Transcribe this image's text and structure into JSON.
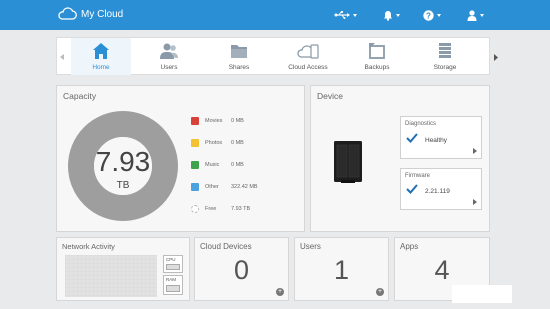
{
  "header": {
    "brand": "My Cloud"
  },
  "nav": {
    "items": [
      {
        "label": "Home",
        "active": true
      },
      {
        "label": "Users"
      },
      {
        "label": "Shares"
      },
      {
        "label": "Cloud Access"
      },
      {
        "label": "Backups"
      },
      {
        "label": "Storage"
      }
    ]
  },
  "capacity": {
    "title": "Capacity",
    "total_value": "7.93",
    "total_unit": "TB",
    "used_fraction": 0.0,
    "rows": [
      {
        "name": "Movies",
        "size": "0 MB",
        "icon": "movies-icon",
        "color": "#d9423a"
      },
      {
        "name": "Photos",
        "size": "0 MB",
        "icon": "photos-icon",
        "color": "#f2c230"
      },
      {
        "name": "Music",
        "size": "0 MB",
        "icon": "music-icon",
        "color": "#3fa34d"
      },
      {
        "name": "Other",
        "size": "322.42 MB",
        "icon": "other-icon",
        "color": "#4aa3df"
      },
      {
        "name": "Free",
        "size": "7.93 TB",
        "icon": "free-icon",
        "color": "#bbbbbb"
      }
    ]
  },
  "device": {
    "title": "Device",
    "diagnostics": {
      "title": "Diagnostics",
      "value": "Healthy"
    },
    "firmware": {
      "title": "Firmware",
      "value": "2.21.119"
    }
  },
  "network": {
    "title": "Network Activity",
    "cpu_label": "CPU",
    "ram_label": "RAM"
  },
  "cloud_devices": {
    "title": "Cloud Devices",
    "count": "0"
  },
  "users": {
    "title": "Users",
    "count": "1"
  },
  "apps": {
    "title": "Apps",
    "count": "4"
  },
  "colors": {
    "accent": "#2a8fd4",
    "ring": "#9e9e9e"
  }
}
